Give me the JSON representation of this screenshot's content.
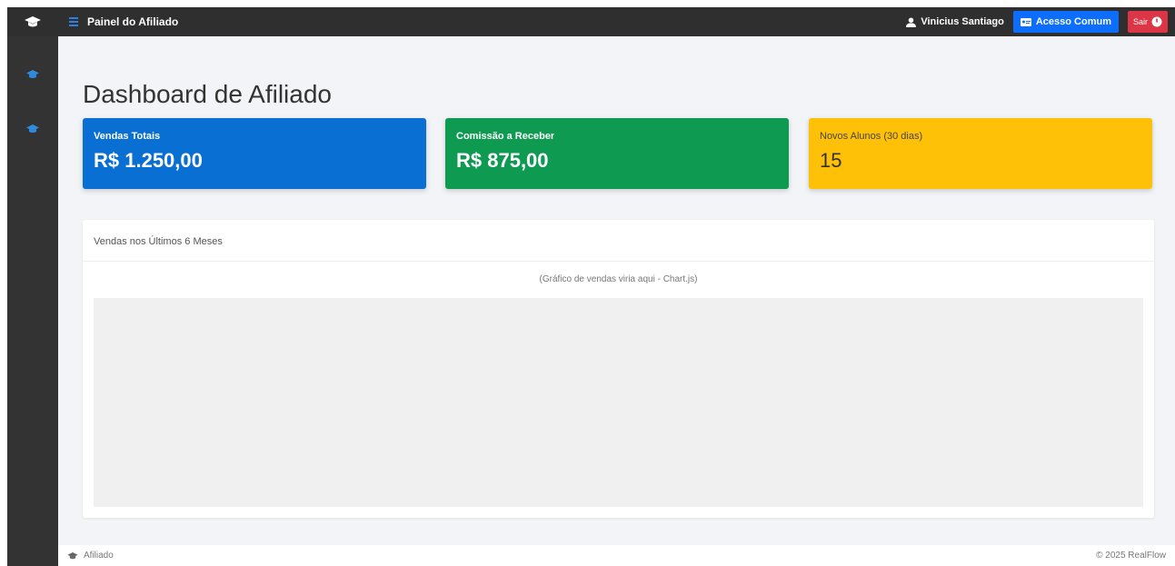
{
  "header": {
    "title": "Painel do Afiliado",
    "user_name": "Vinicius Santiago",
    "access_button": "Acesso Comum",
    "exit_button": "Sair"
  },
  "sidebar": {
    "items": [
      {
        "icon": "cap-icon"
      },
      {
        "icon": "cap-icon"
      }
    ]
  },
  "main": {
    "page_title": "Dashboard de Afiliado",
    "cards": [
      {
        "label": "Vendas Totais",
        "value": "R$ 1.250,00",
        "color": "#0a6fd2"
      },
      {
        "label": "Comissão a Receber",
        "value": "R$ 875,00",
        "color": "#0f9a52"
      },
      {
        "label": "Novos Alunos (30 dias)",
        "value": "15",
        "color": "#ffc107"
      }
    ],
    "panel": {
      "title": "Vendas nos Últimos 6 Meses",
      "chart_caption": "(Gráfico de vendas viria aqui - Chart.js)"
    }
  },
  "footer": {
    "left_text": "Afiliado",
    "right_text": "© 2025 RealFlow"
  },
  "colors": {
    "topbar": "#2f2f2f",
    "sidebar": "#333333",
    "accent_blue": "#0d6efd",
    "danger_red": "#dc3545"
  }
}
